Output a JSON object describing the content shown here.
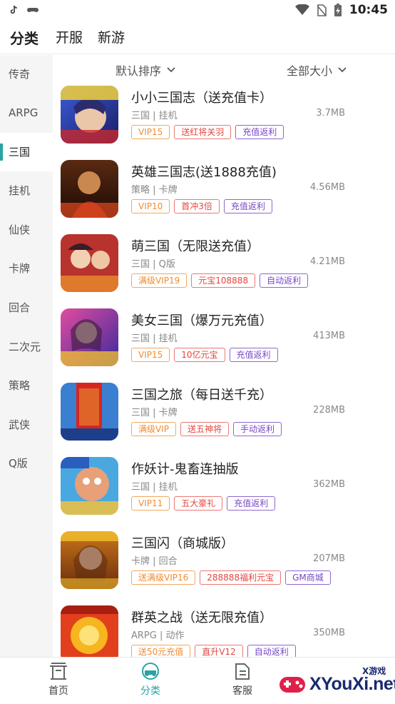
{
  "status_bar": {
    "time": "10:45"
  },
  "top_nav": {
    "tabs": [
      "分类",
      "开服",
      "新游"
    ]
  },
  "sidebar": {
    "items": [
      "传奇",
      "ARPG",
      "三国",
      "挂机",
      "仙侠",
      "卡牌",
      "回合",
      "二次元",
      "策略",
      "武侠",
      "Q版"
    ],
    "active": "三国"
  },
  "sort_bar": {
    "sort_label": "默认排序",
    "size_label": "全部大小"
  },
  "games": [
    {
      "title": "小小三国志（送充值卡）",
      "meta": "三国 | 挂机",
      "size": "3.7MB",
      "tags": [
        "VIP15",
        "送红将关羽",
        "充值返利"
      ]
    },
    {
      "title": "英雄三国志(送1888充值)",
      "meta": "策略 | 卡牌",
      "size": "4.56MB",
      "tags": [
        "VIP10",
        "首冲3倍",
        "充值返利"
      ]
    },
    {
      "title": "萌三国（无限送充值）",
      "meta": "三国 | Q版",
      "size": "4.21MB",
      "tags": [
        "满级VIP19",
        "元宝108888",
        "自动返利"
      ]
    },
    {
      "title": "美女三国（爆万元充值）",
      "meta": "三国 | 挂机",
      "size": "413MB",
      "tags": [
        "VIP15",
        "10亿元宝",
        "充值返利"
      ]
    },
    {
      "title": "三国之旅（每日送千充）",
      "meta": "三国 | 卡牌",
      "size": "228MB",
      "tags": [
        "满级VIP",
        "送五神将",
        "手动返利"
      ]
    },
    {
      "title": "作妖计-鬼畜连抽版",
      "meta": "三国 | 挂机",
      "size": "362MB",
      "tags": [
        "VIP11",
        "五大豪礼",
        "充值返利"
      ]
    },
    {
      "title": "三国闪（商城版）",
      "meta": "卡牌 | 回合",
      "size": "207MB",
      "tags": [
        "送满级VIP16",
        "288888福利元宝",
        "GM商城"
      ]
    },
    {
      "title": "群英之战（送无限充值）",
      "meta": "ARPG | 动作",
      "size": "350MB",
      "tags": [
        "送50元充值",
        "直升V12",
        "自动返利"
      ]
    }
  ],
  "bottom_nav": {
    "items": [
      "首页",
      "分类",
      "客服"
    ],
    "active": "分类"
  },
  "watermark": {
    "text": "XYouXi.net",
    "sub": "X游戏"
  },
  "colors": {
    "accent": "#2aa3a3",
    "tag_orange": "#f08c2e",
    "tag_red": "#e3463f",
    "tag_purple": "#7648c4"
  }
}
